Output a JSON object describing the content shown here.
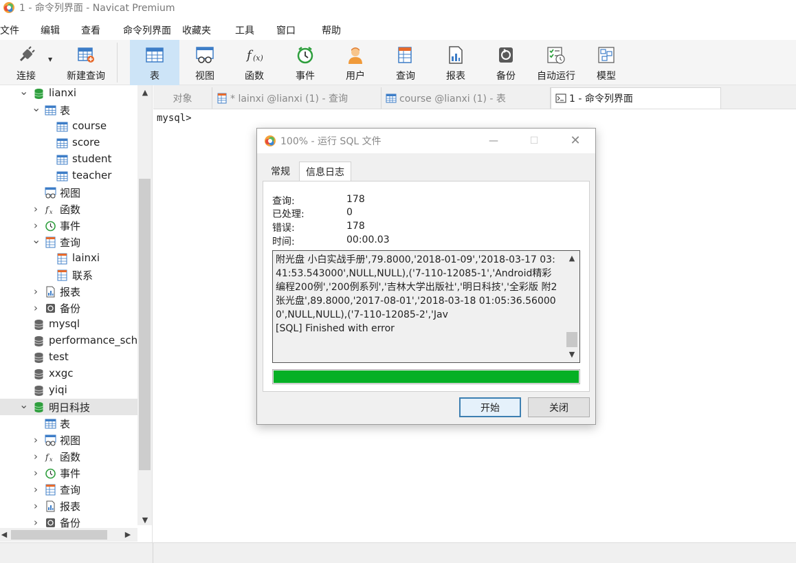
{
  "window": {
    "title": "1 - 命令列界面 - Navicat Premium"
  },
  "menu": [
    "文件",
    "编辑",
    "查看",
    "命令列界面",
    "收藏夹",
    "工具",
    "窗口",
    "帮助"
  ],
  "toolbar": {
    "connect": "连接",
    "new_query": "新建查询",
    "table": "表",
    "view": "视图",
    "function": "函数",
    "event": "事件",
    "user": "用户",
    "query": "查询",
    "report": "报表",
    "backup": "备份",
    "autorun": "自动运行",
    "model": "模型"
  },
  "tree": [
    {
      "label": "lianxi",
      "icon": "database-green-icon",
      "arrow": "down"
    },
    {
      "label": "表",
      "icon": "table-icon",
      "arrow": "down"
    },
    {
      "label": "course",
      "icon": "table-icon",
      "arrow": ""
    },
    {
      "label": "score",
      "icon": "table-icon",
      "arrow": ""
    },
    {
      "label": "student",
      "icon": "table-icon",
      "arrow": ""
    },
    {
      "label": "teacher",
      "icon": "table-icon",
      "arrow": ""
    },
    {
      "label": "视图",
      "icon": "view-icon",
      "arrow": ""
    },
    {
      "label": "函数",
      "icon": "function-icon",
      "arrow": "right"
    },
    {
      "label": "事件",
      "icon": "event-icon",
      "arrow": "right"
    },
    {
      "label": "查询",
      "icon": "query-icon",
      "arrow": "down"
    },
    {
      "label": "lainxi",
      "icon": "query-icon",
      "arrow": ""
    },
    {
      "label": "联系",
      "icon": "query-icon",
      "arrow": ""
    },
    {
      "label": "报表",
      "icon": "report-icon",
      "arrow": "right"
    },
    {
      "label": "备份",
      "icon": "backup-icon",
      "arrow": "right"
    },
    {
      "label": "mysql",
      "icon": "database-gray-icon",
      "arrow": ""
    },
    {
      "label": "performance_schema",
      "icon": "database-gray-icon",
      "arrow": ""
    },
    {
      "label": "test",
      "icon": "database-gray-icon",
      "arrow": ""
    },
    {
      "label": "xxgc",
      "icon": "database-gray-icon",
      "arrow": ""
    },
    {
      "label": "yiqi",
      "icon": "database-gray-icon",
      "arrow": ""
    },
    {
      "label": "明日科技",
      "icon": "database-green-icon",
      "arrow": "down"
    },
    {
      "label": "表",
      "icon": "table-icon",
      "arrow": ""
    },
    {
      "label": "视图",
      "icon": "view-icon",
      "arrow": "right"
    },
    {
      "label": "函数",
      "icon": "function-icon",
      "arrow": "right"
    },
    {
      "label": "事件",
      "icon": "event-icon",
      "arrow": "right"
    },
    {
      "label": "查询",
      "icon": "query-icon",
      "arrow": "right"
    },
    {
      "label": "报表",
      "icon": "report-icon",
      "arrow": "right"
    },
    {
      "label": "备份",
      "icon": "backup-icon",
      "arrow": "right"
    }
  ],
  "tabs": {
    "objects": "对象",
    "query_tab": "* lainxi @lianxi (1) - 查询",
    "table_tab": "course @lianxi (1) - 表",
    "console_tab": "1 - 命令列界面"
  },
  "console": {
    "prompt": "mysql>"
  },
  "dialog": {
    "title": "100% - 运行 SQL 文件",
    "tab_general": "常规",
    "tab_log": "信息日志",
    "stats": [
      {
        "key": "查询:",
        "value": "178"
      },
      {
        "key": "已处理:",
        "value": "0"
      },
      {
        "key": "错误:",
        "value": "178"
      },
      {
        "key": "时间:",
        "value": "00:00.03"
      }
    ],
    "log_text": "附光盘 小白实战手册',79.8000,'2018-01-09','2018-03-17 03:41:53.543000',NULL,NULL),('7-110-12085-1','Android精彩编程200例','200例系列','吉林大学出版社','明日科技','全彩版 附2张光盘',89.8000,'2017-08-01','2018-03-18 01:05:36.560000',NULL,NULL),('7-110-12085-2','Jav\n[SQL] Finished with error",
    "progress": 1.0,
    "progress_color": "#06b025",
    "start_button": "开始",
    "close_button": "关闭"
  }
}
